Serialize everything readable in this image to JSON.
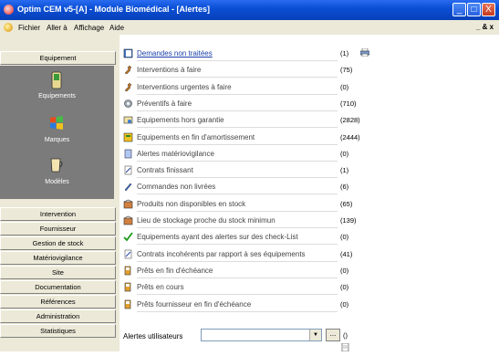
{
  "window": {
    "title": "Optim CEM v5-[A] - Module Biomédical - [Alertes]",
    "controls": {
      "minimize": "_",
      "maximize": "□",
      "close": "X"
    }
  },
  "menu": {
    "items": [
      "Fichier",
      "Aller à",
      "Affichage",
      "Aide"
    ],
    "mdi_controls": "_ & x"
  },
  "sidebar": {
    "top_button": "Equipement",
    "panel_items": [
      {
        "label": "Equipements",
        "icon": "phone-device-icon"
      },
      {
        "label": "Marques",
        "icon": "windows-flag-icon"
      },
      {
        "label": "Modèles",
        "icon": "cup-icon"
      }
    ],
    "buttons": [
      "Intervention",
      "Fournisseur",
      "Gestion de stock",
      "Matériovigilance",
      "Site",
      "Documentation",
      "Références",
      "Administration",
      "Statistiques"
    ]
  },
  "alerts": [
    {
      "label": "Demandes non traitées",
      "count": "(1)",
      "icon": "book-icon",
      "link": true
    },
    {
      "label": "Interventions à faire",
      "count": "(75)",
      "icon": "wrench-icon"
    },
    {
      "label": "Interventions urgentes à faire",
      "count": "(0)",
      "icon": "wrench-icon"
    },
    {
      "label": "Préventifs à faire",
      "count": "(710)",
      "icon": "gear-icon"
    },
    {
      "label": "Equipements hors garantie",
      "count": "(2828)",
      "icon": "certificate-icon"
    },
    {
      "label": "Equipements en fin d'amortissement",
      "count": "(2444)",
      "icon": "cabinet-icon"
    },
    {
      "label": "Alertes matériovigilance",
      "count": "(0)",
      "icon": "alert-doc-icon"
    },
    {
      "label": "Contrats finissant",
      "count": "(1)",
      "icon": "contract-icon"
    },
    {
      "label": "Commandes non livrées",
      "count": "(6)",
      "icon": "pen-icon"
    },
    {
      "label": "Produits non disponibles en stock",
      "count": "(65)",
      "icon": "box-icon"
    },
    {
      "label": "Lieu de stockage proche du stock minimun",
      "count": "(139)",
      "icon": "box-icon"
    },
    {
      "label": "Equipements ayant des alertes sur des check-List",
      "count": "(0)",
      "icon": "checkmark-icon"
    },
    {
      "label": "Contrats incohérents par rapport à ses équipements",
      "count": "(41)",
      "icon": "contract-icon"
    },
    {
      "label": "Prêts en fin d'échéance",
      "count": "(0)",
      "icon": "loan-icon"
    },
    {
      "label": "Prêts en cours",
      "count": "(0)",
      "icon": "loan-icon"
    },
    {
      "label": "Prêts fournisseur en fin d'échéance",
      "count": "(0)",
      "icon": "loan-icon"
    }
  ],
  "user_alerts": {
    "label": "Alertes utilisateurs",
    "value": "",
    "button": "...",
    "count": "()"
  }
}
